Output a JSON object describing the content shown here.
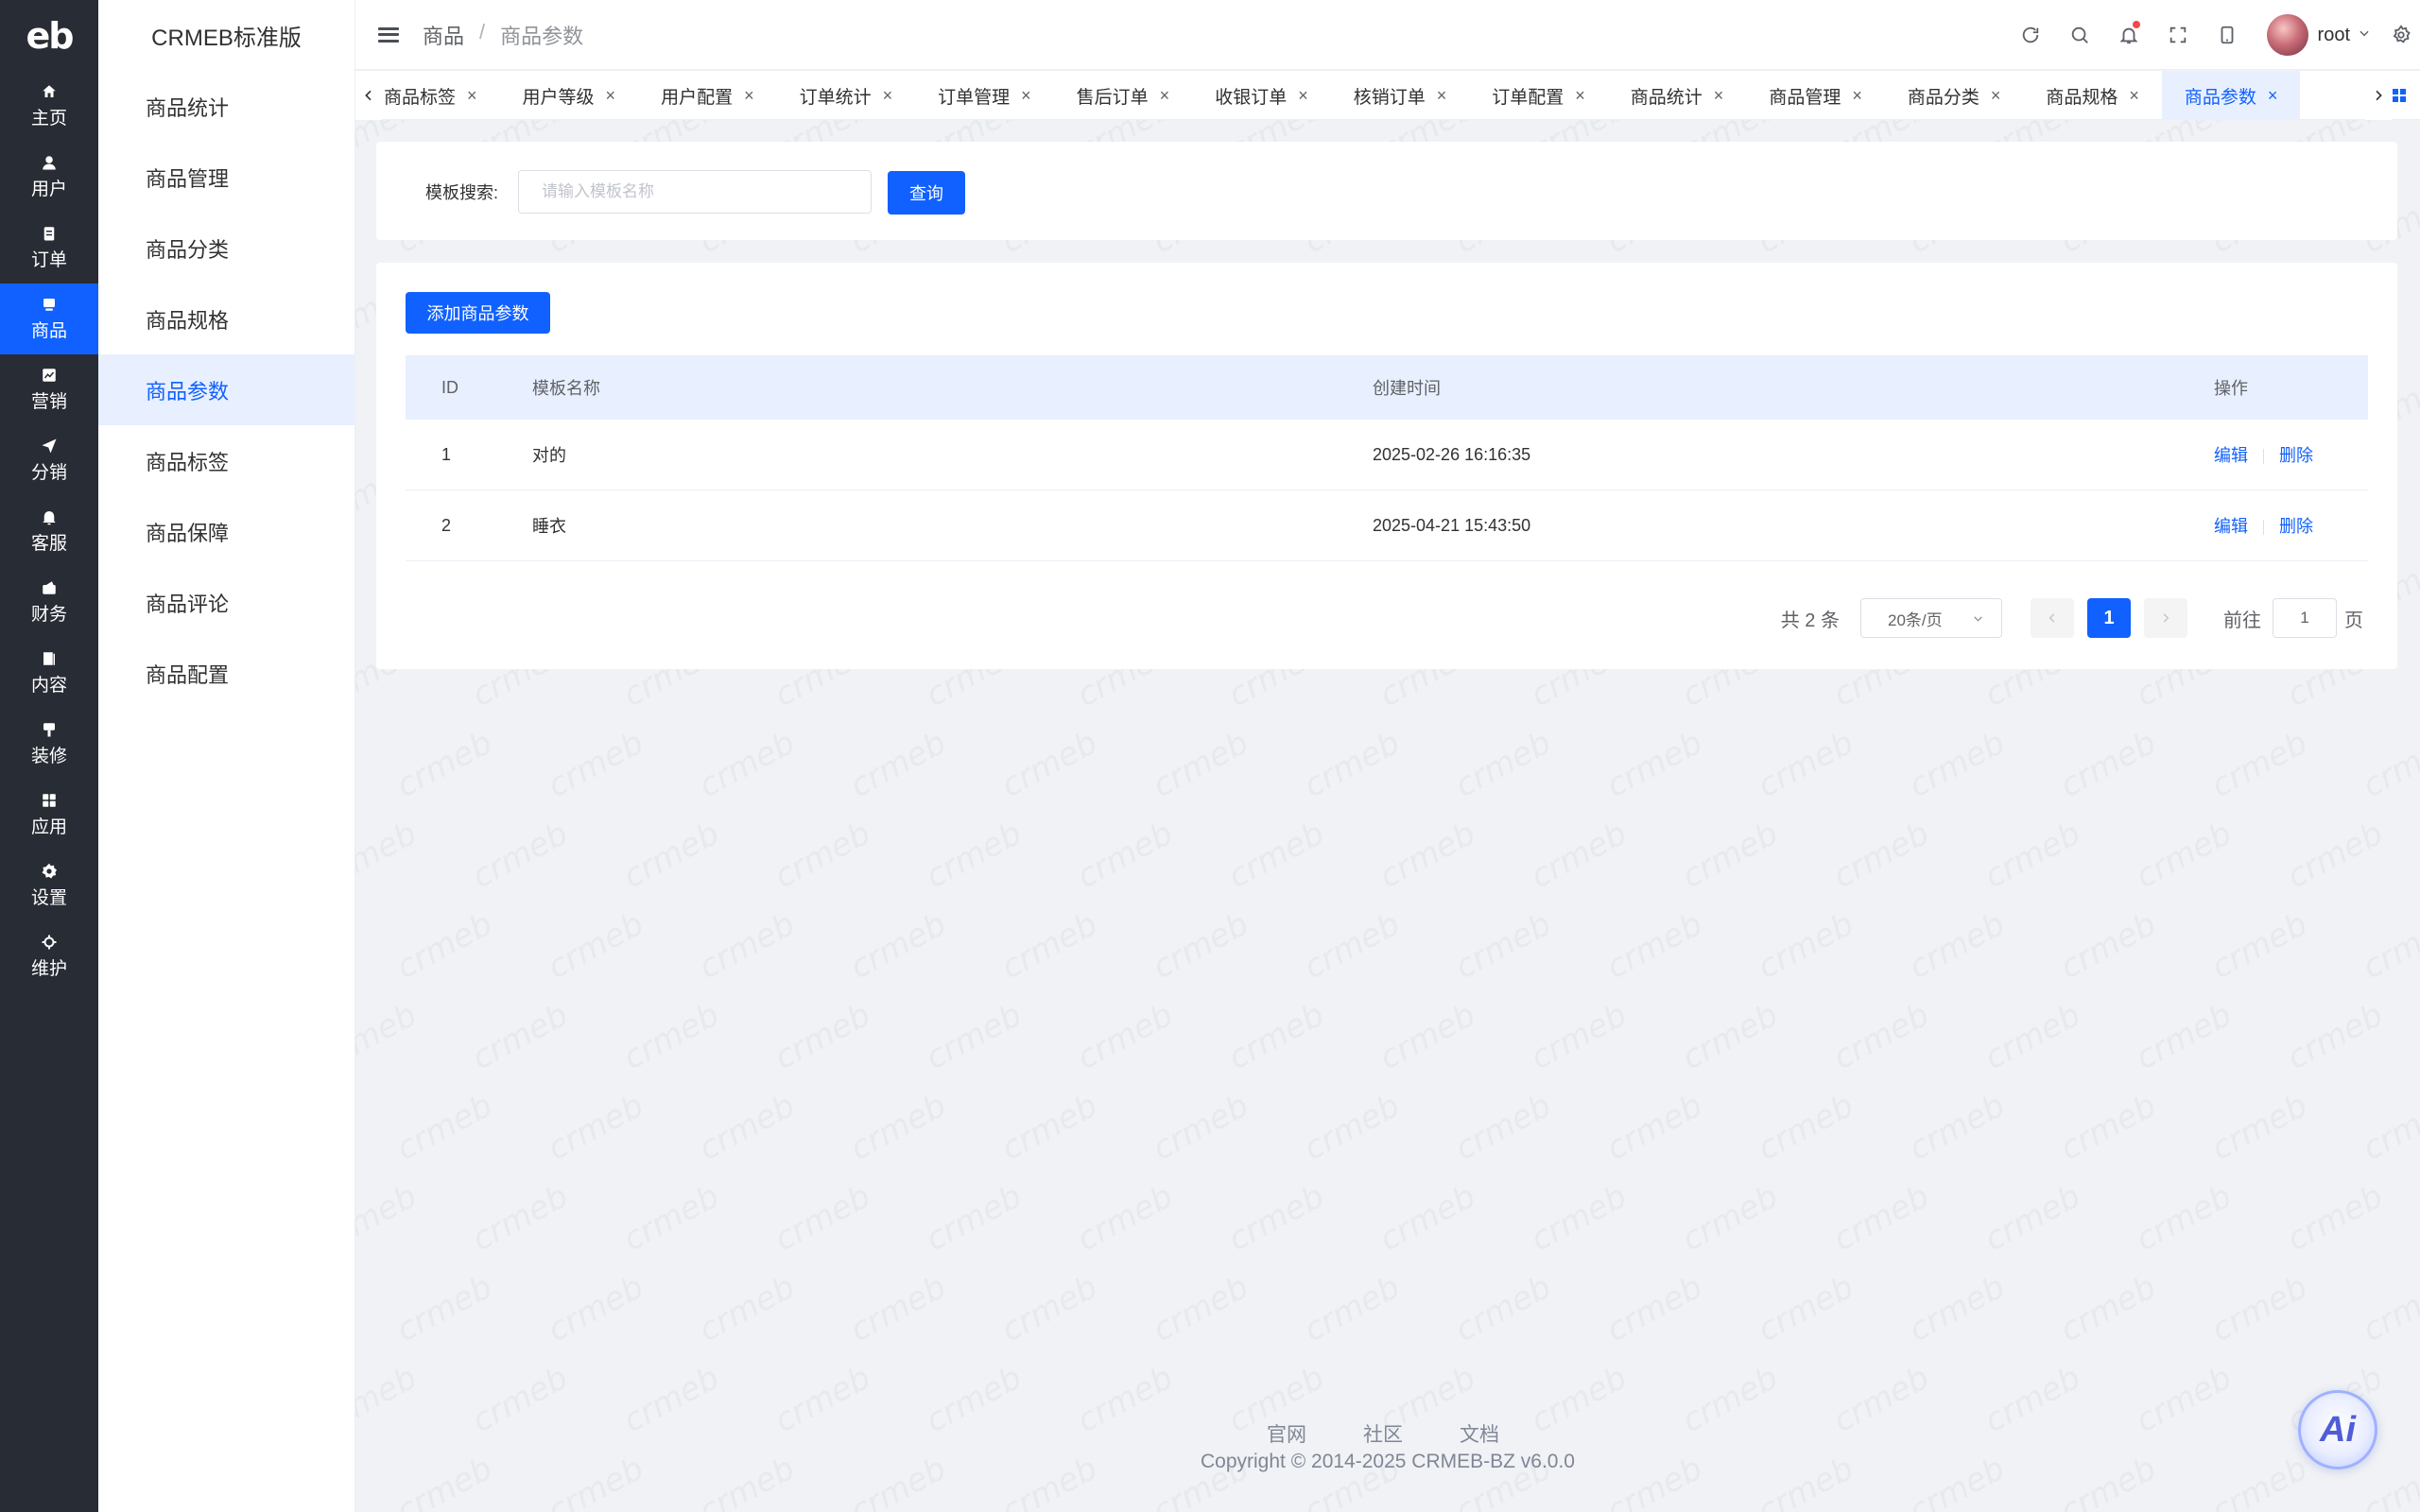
{
  "brand": {
    "logo_text": "eb",
    "app_title": "CRMEB标准版"
  },
  "rail": {
    "items": [
      {
        "label": "主页",
        "icon": "home-icon"
      },
      {
        "label": "用户",
        "icon": "user-icon"
      },
      {
        "label": "订单",
        "icon": "order-icon"
      },
      {
        "label": "商品",
        "icon": "goods-icon",
        "active": true
      },
      {
        "label": "营销",
        "icon": "marketing-icon"
      },
      {
        "label": "分销",
        "icon": "send-icon"
      },
      {
        "label": "客服",
        "icon": "bell-icon"
      },
      {
        "label": "财务",
        "icon": "finance-icon"
      },
      {
        "label": "内容",
        "icon": "content-icon"
      },
      {
        "label": "装修",
        "icon": "decorate-icon"
      },
      {
        "label": "应用",
        "icon": "apps-icon"
      },
      {
        "label": "设置",
        "icon": "settings-icon"
      },
      {
        "label": "维护",
        "icon": "maintain-icon"
      }
    ]
  },
  "subnav": {
    "items": [
      {
        "label": "商品统计"
      },
      {
        "label": "商品管理"
      },
      {
        "label": "商品分类"
      },
      {
        "label": "商品规格"
      },
      {
        "label": "商品参数",
        "active": true
      },
      {
        "label": "商品标签"
      },
      {
        "label": "商品保障"
      },
      {
        "label": "商品评论"
      },
      {
        "label": "商品配置"
      }
    ]
  },
  "header": {
    "breadcrumb": [
      "商品",
      "/",
      "商品参数"
    ],
    "user_name": "root",
    "icons": [
      "refresh-icon",
      "search-icon",
      "bell-icon",
      "fullscreen-icon",
      "tablet-icon",
      "settings-icon"
    ]
  },
  "tabs": [
    {
      "label": "商品标签"
    },
    {
      "label": "用户等级"
    },
    {
      "label": "用户配置"
    },
    {
      "label": "订单统计"
    },
    {
      "label": "订单管理"
    },
    {
      "label": "售后订单"
    },
    {
      "label": "收银订单"
    },
    {
      "label": "核销订单"
    },
    {
      "label": "订单配置"
    },
    {
      "label": "商品统计"
    },
    {
      "label": "商品管理"
    },
    {
      "label": "商品分类"
    },
    {
      "label": "商品规格"
    },
    {
      "label": "商品参数",
      "active": true
    }
  ],
  "search": {
    "label": "模板搜索:",
    "placeholder": "请输入模板名称",
    "value": "",
    "button": "查询"
  },
  "table": {
    "add_button": "添加商品参数",
    "columns": [
      "ID",
      "模板名称",
      "创建时间",
      "操作"
    ],
    "rows": [
      {
        "id": "1",
        "name": "对的",
        "created": "2025-02-26 16:16:35",
        "edit": "编辑",
        "delete": "删除"
      },
      {
        "id": "2",
        "name": "睡衣",
        "created": "2025-04-21 15:43:50",
        "edit": "编辑",
        "delete": "删除"
      }
    ]
  },
  "pagination": {
    "total": "共 2 条",
    "page_size": "20条/页",
    "current_page": "1",
    "goto_label": "前往",
    "goto_value": "1",
    "page_suffix": "页"
  },
  "footer": {
    "links": [
      "官网",
      "社区",
      "文档"
    ],
    "copyright": "Copyright © 2014-2025 CRMEB-BZ v6.0.0"
  },
  "ai_button": {
    "label": "Ai"
  },
  "watermark": "crmeb",
  "colors": {
    "accent": "#1061ff",
    "rail_bg": "#282c34",
    "page_bg": "#f0f2f5",
    "active_bg": "#e8f0ff"
  }
}
